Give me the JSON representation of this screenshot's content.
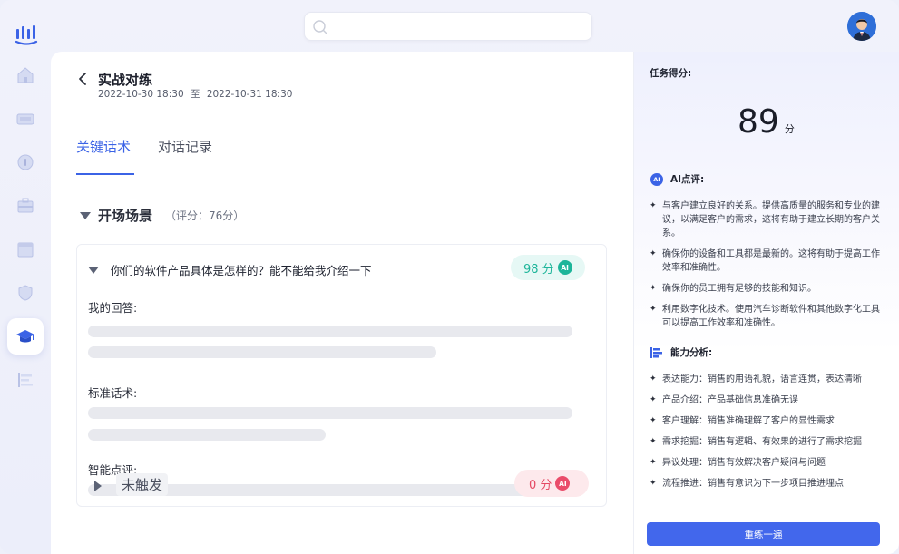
{
  "search": {
    "placeholder": ""
  },
  "sidebar": {
    "items": [
      {
        "icon": "home-icon"
      },
      {
        "icon": "video-icon"
      },
      {
        "icon": "compass-icon"
      },
      {
        "icon": "briefcase-icon"
      },
      {
        "icon": "calendar-icon"
      },
      {
        "icon": "shield-icon"
      },
      {
        "icon": "graduation-cap-icon",
        "active": true
      },
      {
        "icon": "bar-list-icon"
      }
    ]
  },
  "header": {
    "title": "实战对练",
    "date_start": "2022-10-30 18:30",
    "date_sep": "至",
    "date_end": "2022-10-31 18:30"
  },
  "tabs": [
    {
      "label": "关键话术",
      "active": true
    },
    {
      "label": "对话记录",
      "active": false
    }
  ],
  "section": {
    "title": "开场场景",
    "score_text": "（评分：76分）",
    "card": {
      "question": "你们的软件产品具体是怎样的？能不能给我介绍一下",
      "score": "98 分",
      "ai_label": "AI",
      "my_answer_label": "我的回答:",
      "standard_label": "标准话术:",
      "smart_comment_label": "智能点评:"
    }
  },
  "untriggered": {
    "label": "未触发",
    "score": "0 分",
    "ai_label": "AI"
  },
  "right_panel": {
    "task_score_label": "任务得分:",
    "score_value": "89",
    "score_unit": "分",
    "ai_comment_title": "AI点评:",
    "ai_comments": [
      "与客户建立良好的关系。提供高质量的服务和专业的建议，以满足客户的需求，这将有助于建立长期的客户关系。",
      "确保你的设备和工具都是最新的。这将有助于提高工作效率和准确性。",
      "确保你的员工拥有足够的技能和知识。",
      "利用数字化技术。使用汽车诊断软件和其他数字化工具可以提高工作效率和准确性。"
    ],
    "ability_title": "能力分析:",
    "abilities": [
      "表达能力：销售的用语礼貌，语言连贯，表达清晰",
      "产品介绍：产品基础信息准确无误",
      "客户理解：销售准确理解了客户的显性需求",
      "需求挖掘：销售有逻辑、有效果的进行了需求挖掘",
      "异议处理：销售有效解决客户疑问与问题",
      "流程推进：销售有意识为下一步项目推进埋点"
    ],
    "redo_button": "重练一遍"
  },
  "colors": {
    "accent": "#3b63e6",
    "success": "#1db59a",
    "danger": "#e54a64"
  }
}
